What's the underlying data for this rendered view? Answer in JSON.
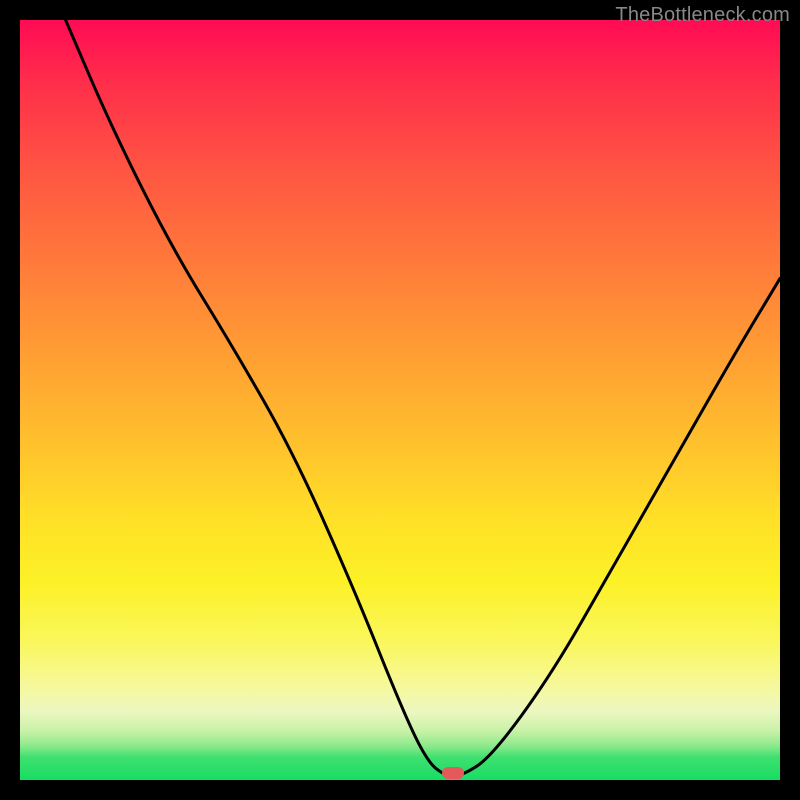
{
  "watermark": "TheBottleneck.com",
  "chart_data": {
    "type": "line",
    "title": "",
    "xlabel": "",
    "ylabel": "",
    "xlim": [
      0,
      100
    ],
    "ylim": [
      0,
      100
    ],
    "grid": false,
    "legend": false,
    "series": [
      {
        "name": "bottleneck-curve",
        "x": [
          6,
          12,
          20,
          28,
          36,
          44,
          50,
          53.5,
          56,
          58,
          62,
          70,
          78,
          86,
          94,
          100
        ],
        "values": [
          100,
          86,
          70,
          57,
          43,
          25,
          10,
          2.5,
          0.5,
          0.5,
          3,
          14,
          28,
          42,
          56,
          66
        ],
        "color": "#000000"
      }
    ],
    "marker": {
      "x": 57,
      "y": 0.9,
      "color": "#e45a5a"
    },
    "background_gradient": {
      "direction": "vertical",
      "stops": [
        {
          "pos": 0.0,
          "color": "#ff0b54"
        },
        {
          "pos": 0.2,
          "color": "#ff5642"
        },
        {
          "pos": 0.44,
          "color": "#ff9e33"
        },
        {
          "pos": 0.66,
          "color": "#ffe127"
        },
        {
          "pos": 0.88,
          "color": "#f6f8a0"
        },
        {
          "pos": 0.95,
          "color": "#8de98b"
        },
        {
          "pos": 1.0,
          "color": "#17dd62"
        }
      ]
    }
  }
}
